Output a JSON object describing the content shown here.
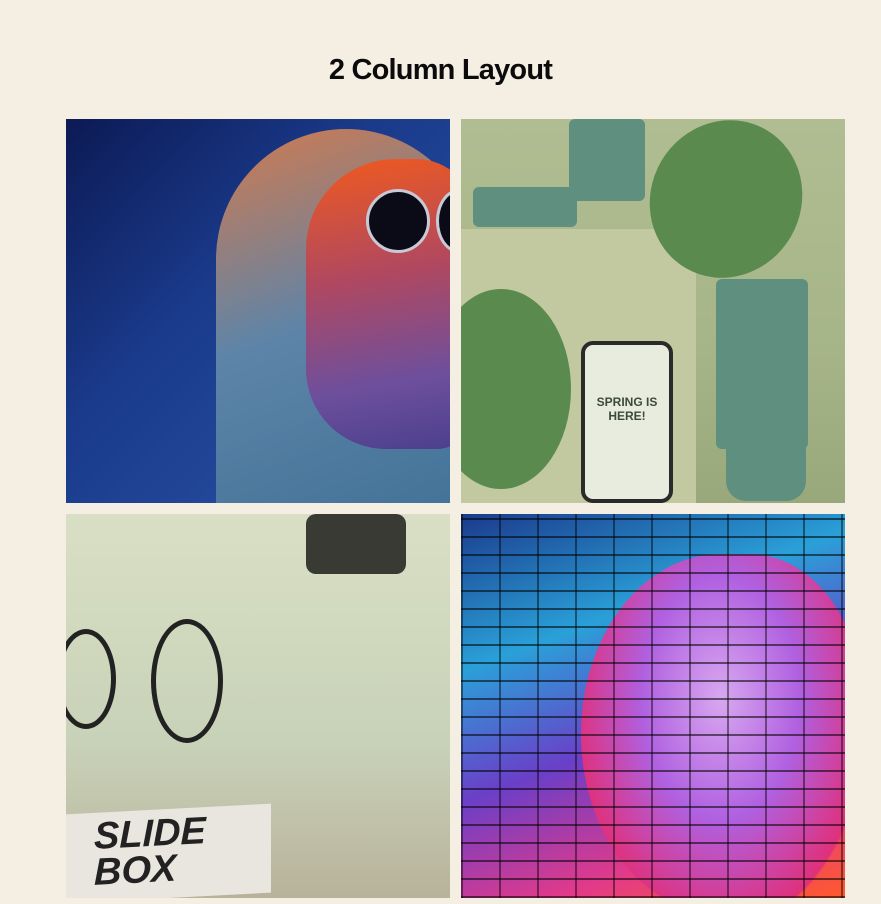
{
  "page": {
    "title": "2 Column Layout"
  },
  "gallery": {
    "images": [
      {
        "name": "hooded-person-sunglasses-photo"
      },
      {
        "name": "green-vases-phone-mockup-photo",
        "phone_text": "SPRING IS HERE!"
      },
      {
        "name": "bmx-rider-jump-photo",
        "banner_text": "SLIDE BOX"
      },
      {
        "name": "graffiti-woman-face-mural-photo"
      }
    ]
  }
}
